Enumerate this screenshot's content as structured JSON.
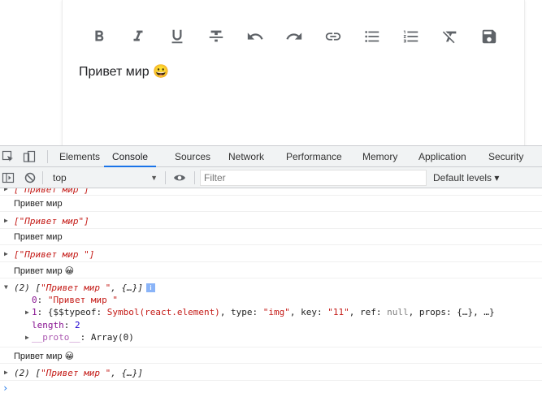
{
  "editor": {
    "toolbar": [
      {
        "name": "bold-icon"
      },
      {
        "name": "italic-icon"
      },
      {
        "name": "underline-icon"
      },
      {
        "name": "strikethrough-icon"
      },
      {
        "name": "undo-icon"
      },
      {
        "name": "redo-icon"
      },
      {
        "name": "link-icon"
      },
      {
        "name": "bulleted-list-icon"
      },
      {
        "name": "numbered-list-icon"
      },
      {
        "name": "clear-formatting-icon"
      },
      {
        "name": "save-icon"
      }
    ],
    "content": "Привет мир 😀"
  },
  "devtools": {
    "tabs": [
      "Elements",
      "Console",
      "Sources",
      "Network",
      "Performance",
      "Memory",
      "Application",
      "Security"
    ],
    "active_tab": "Console",
    "accent_color": "#1a73e8",
    "context": "top",
    "filter_placeholder": "Filter",
    "levels_label": "Default levels ▾",
    "logs": {
      "r0_text": "[\"Привет мир\"]",
      "r1_text": "Привет мир",
      "r2_text": "[\"Привет мир\"]",
      "r3_text": "Привет мир",
      "r4_text": "[\"Привет мир \"]",
      "r5_text": "Привет мир 😀",
      "r6_prefix": "(2) [",
      "r6_str": "\"Привет мир \"",
      "r6_suffix": ", {…}]",
      "r6_info": "i",
      "r6_l1_key": "0",
      "r6_l1_val": "\"Привет мир \"",
      "r6_l2_key": "1",
      "r6_l2_a": "{$$typeof: ",
      "r6_l2_sym": "Symbol(react.element)",
      "r6_l2_b": ", type: ",
      "r6_l2_type": "\"img\"",
      "r6_l2_c": ", key: ",
      "r6_l2_keyv": "\"11\"",
      "r6_l2_d": ", ref: ",
      "r6_l2_ref": "null",
      "r6_l2_e": ", props: {…}, …}",
      "r6_l3_key": "length",
      "r6_l3_val": "2",
      "r6_l4_key": "__proto__",
      "r6_l4_val": ": Array(0)",
      "r7_text": "Привет мир 😀",
      "r8_prefix": "(2) [",
      "r8_str": "\"Привет мир \"",
      "r8_suffix": ", {…}]"
    },
    "prompt": "›"
  }
}
